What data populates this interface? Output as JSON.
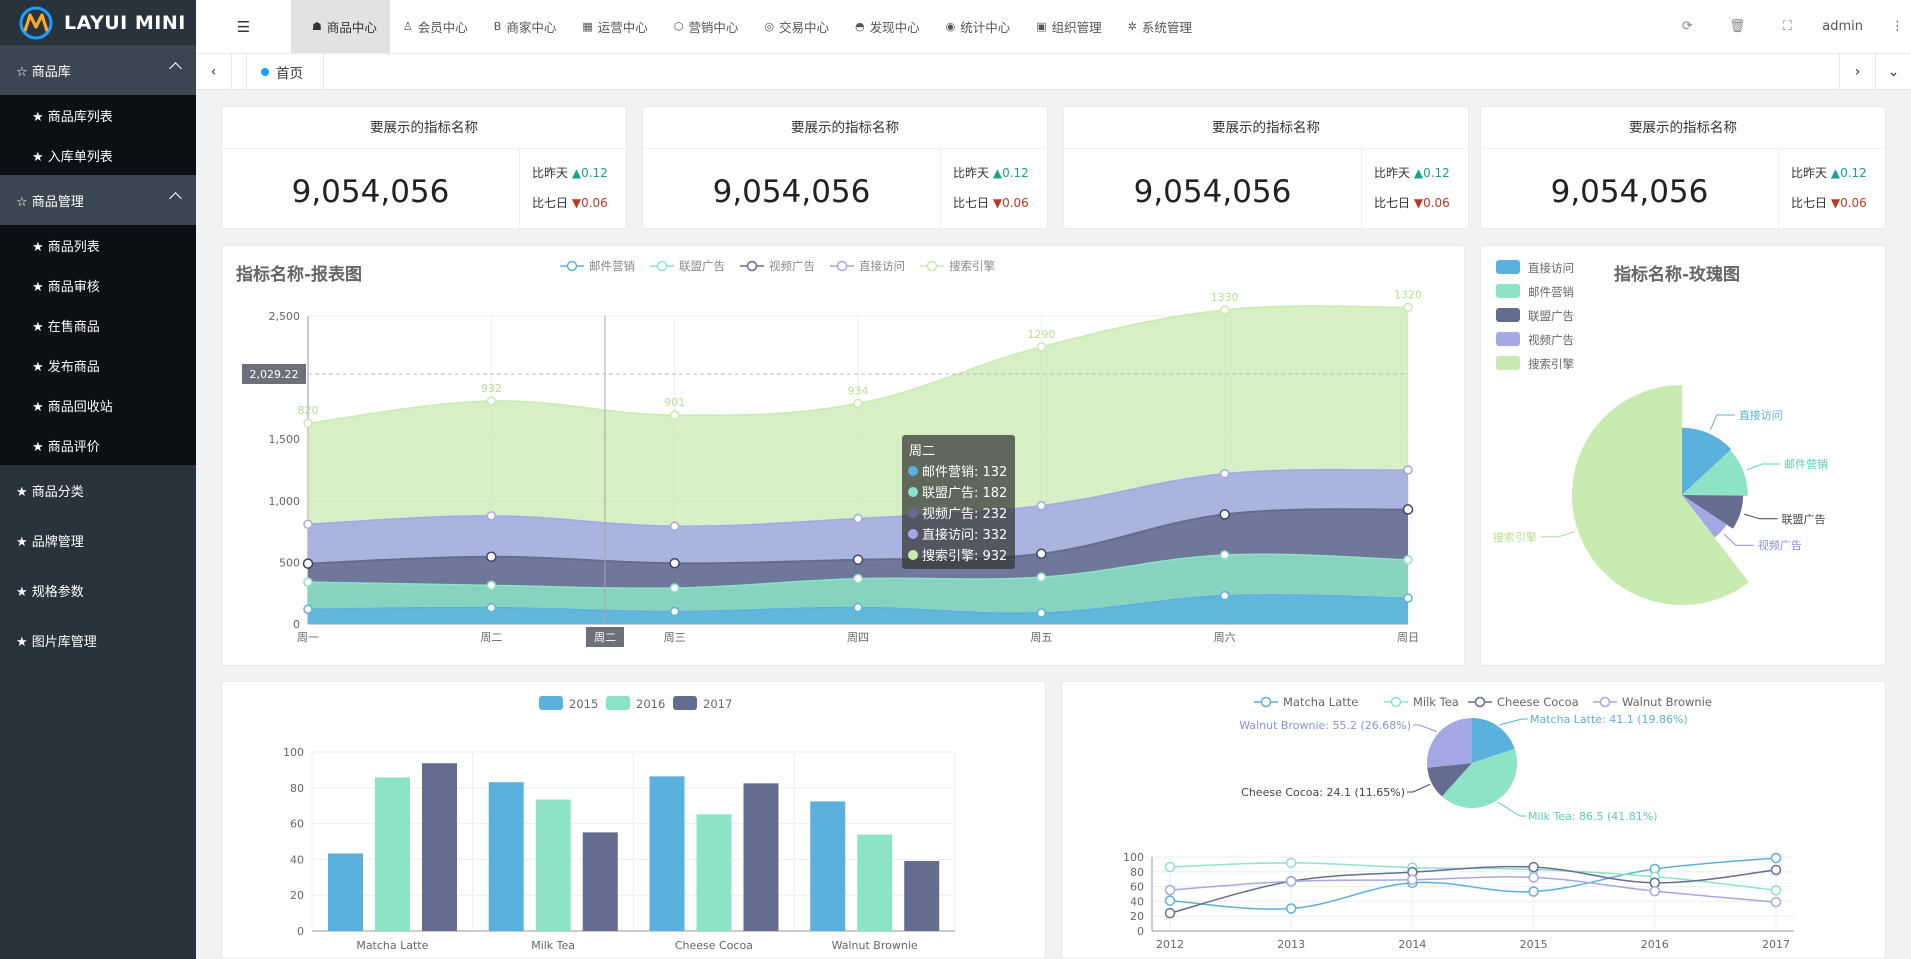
{
  "app": {
    "title": "LAYUI MINI"
  },
  "sidebar": {
    "groups": [
      {
        "label": "☆ 商品库",
        "open": true,
        "items": [
          {
            "label": "★ 商品库列表"
          },
          {
            "label": "★ 入库单列表"
          }
        ]
      },
      {
        "label": "☆ 商品管理",
        "open": true,
        "items": [
          {
            "label": "★ 商品列表"
          },
          {
            "label": "★ 商品审核"
          },
          {
            "label": "★ 在售商品"
          },
          {
            "label": "★ 发布商品"
          },
          {
            "label": "★ 商品回收站"
          },
          {
            "label": "★ 商品评价"
          }
        ]
      },
      {
        "label": "★ 商品分类",
        "open": false,
        "items": []
      },
      {
        "label": "★ 品牌管理",
        "open": false,
        "items": []
      },
      {
        "label": "★ 规格参数",
        "open": false,
        "items": []
      },
      {
        "label": "★ 图片库管理",
        "open": false,
        "items": []
      }
    ]
  },
  "header": {
    "menus": [
      {
        "icon": "☗",
        "label": "商品中心",
        "active": true
      },
      {
        "icon": "♙",
        "label": "会员中心"
      },
      {
        "icon": "B",
        "label": "商家中心"
      },
      {
        "icon": "▦",
        "label": "运营中心"
      },
      {
        "icon": "⬡",
        "label": "营销中心"
      },
      {
        "icon": "◎",
        "label": "交易中心"
      },
      {
        "icon": "◓",
        "label": "发现中心"
      },
      {
        "icon": "◉",
        "label": "统计中心"
      },
      {
        "icon": "▣",
        "label": "组织管理"
      },
      {
        "icon": "✲",
        "label": "系统管理"
      }
    ],
    "tools": {
      "refresh": "⟳",
      "clear": "🗑",
      "fullscreen": "⛶",
      "user": "admin",
      "more": "⋮"
    }
  },
  "tabs": {
    "home": "首页"
  },
  "kpis": [
    {
      "title": "要展示的指标名称",
      "value": "9,054,056",
      "cmp1_label": "比昨天",
      "cmp1_val": "0.12",
      "cmp2_label": "比七日",
      "cmp2_val": "0.06"
    },
    {
      "title": "要展示的指标名称",
      "value": "9,054,056",
      "cmp1_label": "比昨天",
      "cmp1_val": "0.12",
      "cmp2_label": "比七日",
      "cmp2_val": "0.06"
    },
    {
      "title": "要展示的指标名称",
      "value": "9,054,056",
      "cmp1_label": "比昨天",
      "cmp1_val": "0.12",
      "cmp2_label": "比七日",
      "cmp2_val": "0.06"
    },
    {
      "title": "要展示的指标名称",
      "value": "9,054,056",
      "cmp1_label": "比昨天",
      "cmp1_val": "0.12",
      "cmp2_label": "比七日",
      "cmp2_val": "0.06"
    }
  ],
  "colors": {
    "c1": "#5bb1dd",
    "c2": "#8de3c6",
    "c3": "#646d8f",
    "c4": "#a3a8e4",
    "c5": "#c9eab0"
  },
  "chart_data": [
    {
      "type": "area",
      "title": "指标名称-报表图",
      "categories": [
        "周一",
        "周二",
        "周三",
        "周四",
        "周五",
        "周六",
        "周日"
      ],
      "series": [
        {
          "name": "邮件营销",
          "values": [
            120,
            132,
            101,
            134,
            90,
            230,
            210
          ]
        },
        {
          "name": "联盟广告",
          "values": [
            220,
            182,
            191,
            234,
            290,
            330,
            310
          ]
        },
        {
          "name": "视频广告",
          "values": [
            150,
            232,
            201,
            154,
            190,
            330,
            410
          ]
        },
        {
          "name": "直接访问",
          "values": [
            320,
            332,
            301,
            334,
            390,
            330,
            320
          ]
        },
        {
          "name": "搜索引擎",
          "values": [
            820,
            932,
            901,
            934,
            1290,
            1330,
            1320
          ]
        }
      ],
      "ylim": [
        0,
        2500
      ],
      "yticks": [
        "0",
        "500",
        "1,000",
        "1,500",
        "2,500"
      ],
      "tooltip": {
        "title": "周二",
        "lines": [
          "邮件营销: 132",
          "联盟广告: 182",
          "视频广告: 232",
          "直接访问: 332",
          "搜索引擎: 932"
        ]
      },
      "pointer_y_label": "2,029.22",
      "pointer_x_label": "周二"
    },
    {
      "type": "pie",
      "title": "指标名称-玫瑰图",
      "legend": [
        "直接访问",
        "邮件营销",
        "联盟广告",
        "视频广告",
        "搜索引擎"
      ],
      "slices": [
        {
          "name": "直接访问",
          "value": 335
        },
        {
          "name": "邮件营销",
          "value": 310
        },
        {
          "name": "联盟广告",
          "value": 234
        },
        {
          "name": "视频广告",
          "value": 135
        },
        {
          "name": "搜索引擎",
          "value": 1548
        }
      ]
    },
    {
      "type": "bar",
      "legend": [
        "2015",
        "2016",
        "2017"
      ],
      "categories": [
        "Matcha Latte",
        "Milk Tea",
        "Cheese Cocoa",
        "Walnut Brownie"
      ],
      "series": [
        {
          "name": "2015",
          "values": [
            43.3,
            83.1,
            86.4,
            72.4
          ]
        },
        {
          "name": "2016",
          "values": [
            85.8,
            73.4,
            65.2,
            53.9
          ]
        },
        {
          "name": "2017",
          "values": [
            93.7,
            55.1,
            82.5,
            39.1
          ]
        }
      ],
      "ylim": [
        0,
        100
      ],
      "yticks": [
        "0",
        "20",
        "40",
        "60",
        "80",
        "100"
      ]
    },
    {
      "type": "pie",
      "legend": [
        "Matcha Latte",
        "Milk Tea",
        "Cheese Cocoa",
        "Walnut Brownie"
      ],
      "slices": [
        {
          "name": "Matcha Latte",
          "value": 41.1,
          "label": "Matcha Latte: 41.1 (19.86%)"
        },
        {
          "name": "Milk Tea",
          "value": 86.5,
          "label": "Milk Tea: 86.5 (41.81%)"
        },
        {
          "name": "Cheese Cocoa",
          "value": 24.1,
          "label": "Cheese Cocoa: 24.1 (11.65%)"
        },
        {
          "name": "Walnut Brownie",
          "value": 55.2,
          "label": "Walnut Brownie: 55.2 (26.68%)"
        }
      ]
    },
    {
      "type": "line",
      "x": [
        "2012",
        "2013",
        "2014",
        "2015",
        "2016",
        "2017"
      ],
      "series": [
        {
          "name": "Matcha Latte",
          "values": [
            41.1,
            30.4,
            65.1,
            53.3,
            83.8,
            98.7
          ]
        },
        {
          "name": "Milk Tea",
          "values": [
            86.5,
            92.1,
            85.7,
            83.1,
            73.4,
            55.1
          ]
        },
        {
          "name": "Cheese Cocoa",
          "values": [
            24.1,
            67.2,
            79.5,
            86.4,
            65.2,
            82.5
          ]
        },
        {
          "name": "Walnut Brownie",
          "values": [
            55.2,
            67.1,
            69.2,
            72.4,
            53.9,
            39.1
          ]
        }
      ],
      "ylim": [
        0,
        100
      ],
      "yticks": [
        "0",
        "20",
        "40",
        "60",
        "80",
        "100"
      ]
    }
  ]
}
